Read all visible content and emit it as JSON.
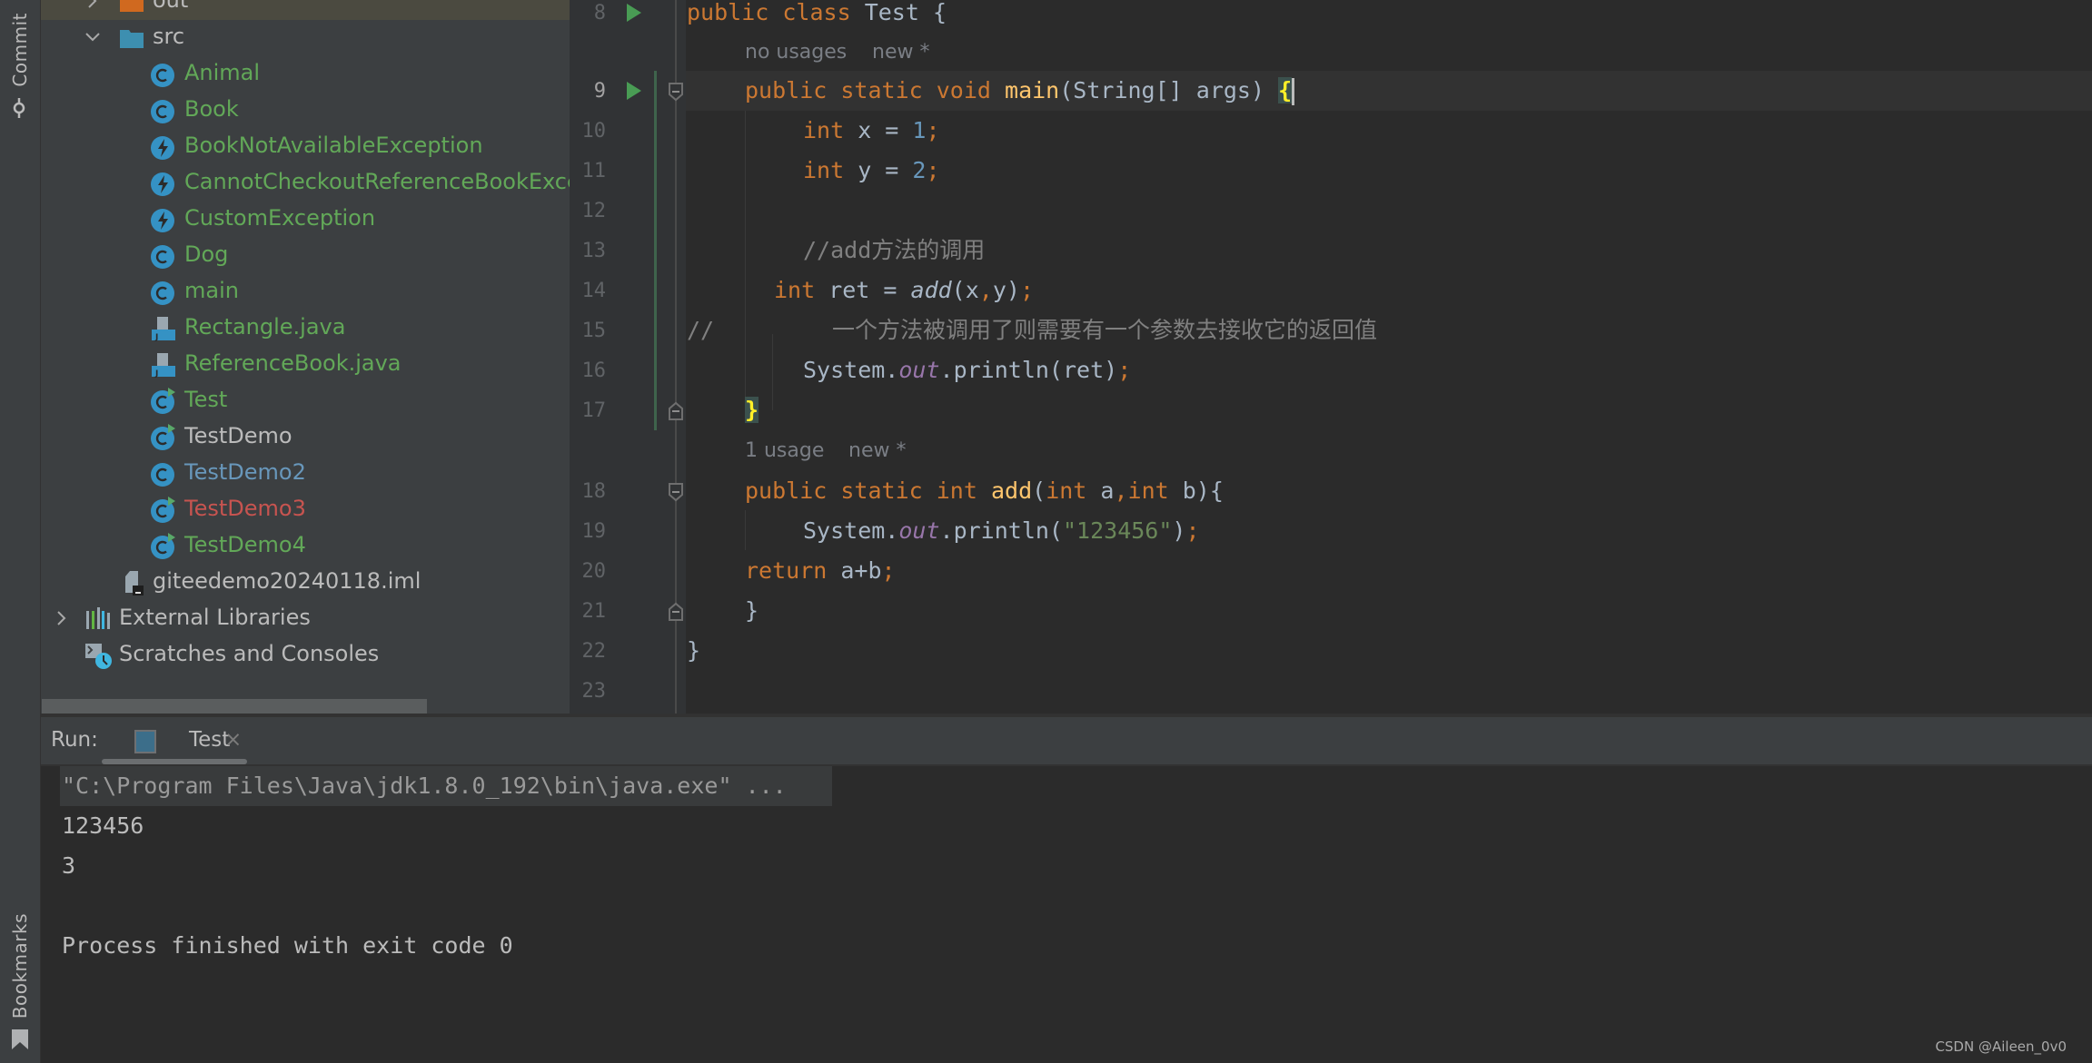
{
  "tool_stripe": {
    "top_label": "Commit",
    "bottom_label": "Bookmarks"
  },
  "project_tree": {
    "items": [
      {
        "label": "out",
        "type": "folder-excluded",
        "expanded": false,
        "color": "#bbbbbb",
        "selected": true
      },
      {
        "label": "src",
        "type": "folder-source",
        "expanded": true,
        "color": "#bbbbbb"
      },
      {
        "label": "Animal",
        "type": "class",
        "color": "#62a858"
      },
      {
        "label": "Book",
        "type": "class",
        "color": "#62a858"
      },
      {
        "label": "BookNotAvailableException",
        "type": "exception",
        "color": "#62a858"
      },
      {
        "label": "CannotCheckoutReferenceBookException",
        "type": "exception",
        "color": "#62a858"
      },
      {
        "label": "CustomException",
        "type": "exception",
        "color": "#62a858"
      },
      {
        "label": "Dog",
        "type": "class",
        "color": "#62a858"
      },
      {
        "label": "main",
        "type": "class",
        "color": "#62a858"
      },
      {
        "label": "Rectangle.java",
        "type": "java-file",
        "color": "#62a858"
      },
      {
        "label": "ReferenceBook.java",
        "type": "java-file",
        "color": "#62a858"
      },
      {
        "label": "Test",
        "type": "class-runnable",
        "color": "#62a858"
      },
      {
        "label": "TestDemo",
        "type": "class-runnable",
        "color": "#bbbbbb"
      },
      {
        "label": "TestDemo2",
        "type": "class",
        "color": "#6897bb"
      },
      {
        "label": "TestDemo3",
        "type": "class-runnable",
        "color": "#c75450"
      },
      {
        "label": "TestDemo4",
        "type": "class-runnable",
        "color": "#62a858"
      },
      {
        "label": "giteedemo20240118.iml",
        "type": "iml-file",
        "color": "#bbbbbb"
      },
      {
        "label": "External Libraries",
        "type": "libraries",
        "expanded": false,
        "color": "#bbbbbb"
      },
      {
        "label": "Scratches and Consoles",
        "type": "scratches",
        "color": "#bbbbbb"
      }
    ]
  },
  "editor": {
    "line_numbers": [
      "8",
      "9",
      "10",
      "11",
      "12",
      "13",
      "14",
      "15",
      "16",
      "17",
      "18",
      "19",
      "20",
      "21",
      "22",
      "23"
    ],
    "current_line": "9",
    "inlays": {
      "main_usages": "no usages",
      "main_author": "new *",
      "add_usages": "1 usage",
      "add_author": "new *"
    },
    "lines": {
      "l8": {
        "kw1": "public",
        "kw2": "class",
        "name": "Test",
        "brace": "{"
      },
      "l9": {
        "kw1": "public",
        "kw2": "static",
        "kw3": "void",
        "fn": "main",
        "params": "(String[] args) ",
        "brace": "{"
      },
      "l10": {
        "kw": "int",
        "rest": " x = ",
        "num": "1",
        "semi": ";"
      },
      "l11": {
        "kw": "int",
        "rest": " y = ",
        "num": "2",
        "semi": ";"
      },
      "l13": {
        "comment": "//add方法的调用"
      },
      "l14": {
        "kw": "int",
        "rest": " ret = ",
        "call": "add",
        "open": "(x",
        "comma": ",",
        "close": "y)",
        "semi": ";"
      },
      "l15": {
        "prefix": "//",
        "comment": "一个方法被调用了则需要有一个参数去接收它的返回值"
      },
      "l16": {
        "obj": "System.",
        "field": "out",
        "call": ".println(ret)",
        "semi": ";"
      },
      "l17": {
        "brace": "}"
      },
      "l18": {
        "kw1": "public",
        "kw2": "static",
        "kw3": "int",
        "fn": "add",
        "p1": "(",
        "kw4": "int",
        "p2": " a",
        "comma": ",",
        "kw5": "int",
        "p3": " b){"
      },
      "l19": {
        "obj": "System.",
        "field": "out",
        "call": ".println(",
        "str": "\"123456\"",
        "close": ")",
        "semi": ";"
      },
      "l20": {
        "kw": "return",
        "rest": " a+b",
        "semi": ";"
      },
      "l21": {
        "brace": "}"
      },
      "l22": {
        "brace": "}"
      }
    }
  },
  "run_panel": {
    "label": "Run:",
    "tab_label": "Test",
    "close_glyph": "×",
    "console_lines": [
      "\"C:\\Program Files\\Java\\jdk1.8.0_192\\bin\\java.exe\" ...",
      "123456",
      "3",
      "",
      "Process finished with exit code 0"
    ]
  },
  "watermark": "CSDN @Aileen_0v0"
}
